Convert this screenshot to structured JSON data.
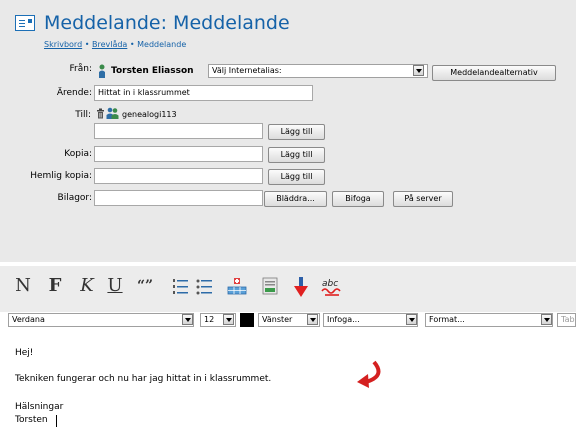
{
  "header": {
    "title": "Meddelande: Meddelande",
    "breadcrumb": {
      "home": "Skrivbord",
      "sep1": "•",
      "mailbox": "Brevlåda",
      "sep2": "•",
      "current": "Meddelande"
    }
  },
  "form": {
    "from_label": "Från:",
    "from_name": "Torsten Eliasson",
    "alias_select": "Välj Internetalias:",
    "message_options_button": "Meddelandealternativ",
    "subject_label": "Ärende:",
    "subject_value": "Hittat in i klassrummet",
    "to_label": "Till:",
    "to_recipient": "genealogi113",
    "to_input": "",
    "add_label": "Lägg till",
    "cc_label": "Kopia:",
    "cc_input": "",
    "bcc_label": "Hemlig kopia:",
    "bcc_input": "",
    "attachments_label": "Bilagor:",
    "browse_button": "Bläddra...",
    "attach_button": "Bifoga",
    "on_server_button": "På server"
  },
  "toolbar": {
    "normal": "N",
    "bold": "F",
    "italic": "K",
    "underline": "U",
    "quote": "“”",
    "font_family": "Verdana",
    "font_size": "12",
    "text_color": "#000000",
    "alignment": "Vänster",
    "insert": "Infoga...",
    "format": "Format...",
    "table_partial": "Tab",
    "icons": [
      "numbered-list-icon",
      "bullet-list-icon",
      "insert-table-icon",
      "insert-image-icon",
      "insert-link-icon",
      "spellcheck-icon"
    ]
  },
  "editor": {
    "lines": [
      "Hej!",
      "Tekniken fungerar och nu har jag hittat in i klassrummet.",
      "Hälsningar",
      "Torsten"
    ]
  },
  "colors": {
    "title_blue": "#1562a8",
    "arrow_red": "#d42020"
  }
}
